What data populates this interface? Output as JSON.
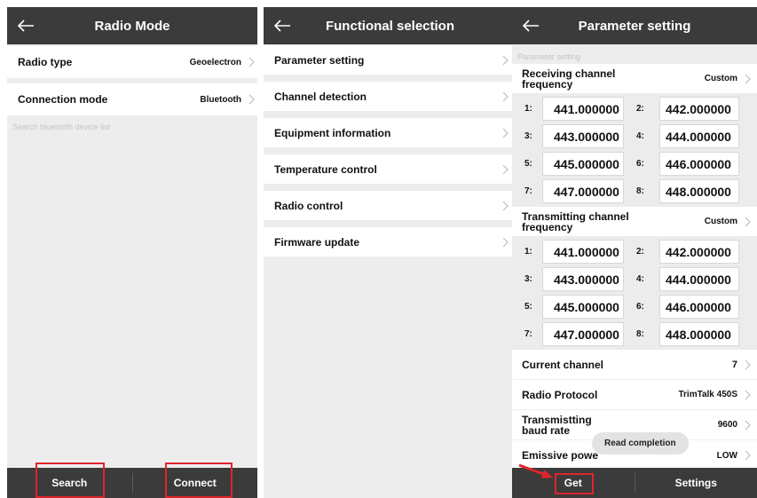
{
  "radio_mode": {
    "title": "Radio Mode",
    "rows": [
      {
        "label": "Radio type",
        "value": "Geoelectron"
      },
      {
        "label": "Connection mode",
        "value": "Bluetooth"
      }
    ],
    "search_hint": "Search bluetooth device list",
    "buttons": {
      "search": "Search",
      "connect": "Connect"
    }
  },
  "functional": {
    "title": "Functional selection",
    "items": [
      {
        "label": "Parameter setting"
      },
      {
        "label": "Channel detection"
      },
      {
        "label": "Equipment information"
      },
      {
        "label": "Temperature control"
      },
      {
        "label": "Radio control"
      },
      {
        "label": "Firmware update"
      }
    ]
  },
  "params": {
    "title": "Parameter setting",
    "section_hint": "Parameter setting",
    "receiving": {
      "label": "Receiving channel frequency",
      "value": "Custom",
      "freqs": [
        {
          "n": "1:",
          "v": "441.000000"
        },
        {
          "n": "2:",
          "v": "442.000000"
        },
        {
          "n": "3:",
          "v": "443.000000"
        },
        {
          "n": "4:",
          "v": "444.000000"
        },
        {
          "n": "5:",
          "v": "445.000000"
        },
        {
          "n": "6:",
          "v": "446.000000"
        },
        {
          "n": "7:",
          "v": "447.000000"
        },
        {
          "n": "8:",
          "v": "448.000000"
        }
      ]
    },
    "transmitting": {
      "label": "Transmitting channel frequency",
      "value": "Custom",
      "freqs": [
        {
          "n": "1:",
          "v": "441.000000"
        },
        {
          "n": "2:",
          "v": "442.000000"
        },
        {
          "n": "3:",
          "v": "443.000000"
        },
        {
          "n": "4:",
          "v": "444.000000"
        },
        {
          "n": "5:",
          "v": "445.000000"
        },
        {
          "n": "6:",
          "v": "446.000000"
        },
        {
          "n": "7:",
          "v": "447.000000"
        },
        {
          "n": "8:",
          "v": "448.000000"
        }
      ]
    },
    "current_channel": {
      "label": "Current channel",
      "value": "7"
    },
    "radio_protocol": {
      "label": "Radio Protocol",
      "value": "TrimTalk 450S"
    },
    "baud_rate": {
      "label": "Transmistting baud rate",
      "value": "9600"
    },
    "emissive_power": {
      "label": "Emissive powe",
      "value": "LOW"
    },
    "toast": "Read completion",
    "buttons": {
      "get": "Get",
      "settings": "Settings"
    }
  }
}
